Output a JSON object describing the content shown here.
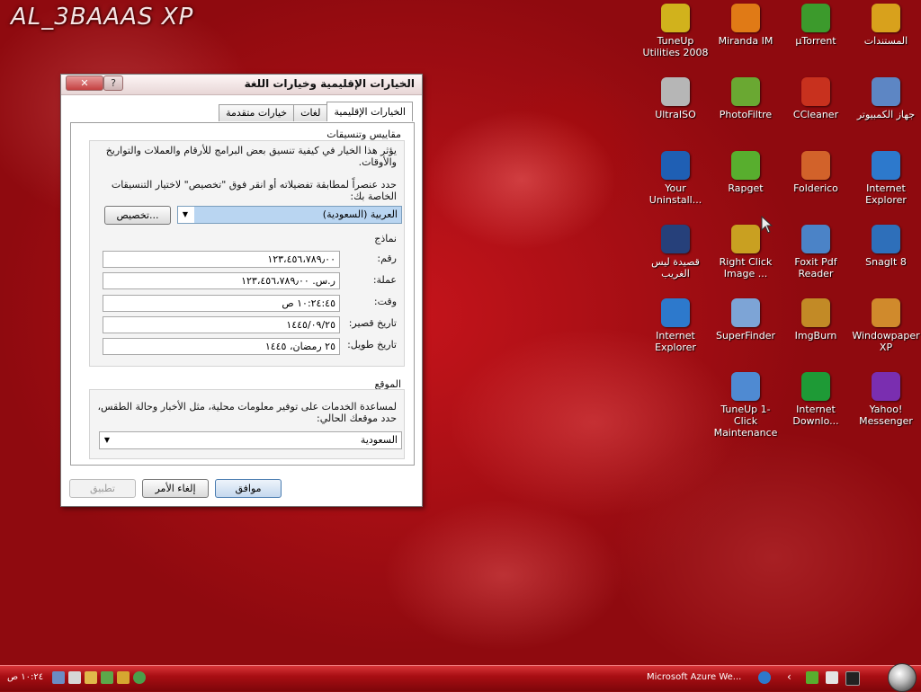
{
  "desktop": {
    "brand_text": "AL_3BAAAS XP",
    "icons": [
      {
        "label": "المستندات",
        "icon": "folder-icon",
        "color": "#d8a11c"
      },
      {
        "label": "µTorrent",
        "icon": "utorrent-icon",
        "color": "#3c9a2c"
      },
      {
        "label": "Miranda IM",
        "icon": "miranda-icon",
        "color": "#e07a16"
      },
      {
        "label": "TuneUp Utilities 2008",
        "icon": "tuneup-icon",
        "color": "#d1b21c"
      },
      {
        "label": "جهاز الكمبيوتر",
        "icon": "computer-icon",
        "color": "#5d86c4"
      },
      {
        "label": "CCleaner",
        "icon": "ccleaner-icon",
        "color": "#c8311e"
      },
      {
        "label": "PhotoFiltre",
        "icon": "photofiltre-icon",
        "color": "#6aa832"
      },
      {
        "label": "UltraISO",
        "icon": "disc-icon",
        "color": "#b6b6b6"
      },
      {
        "label": "Internet Explorer",
        "icon": "ie-icon",
        "color": "#2d79cc"
      },
      {
        "label": "Folderico",
        "icon": "folderico-icon",
        "color": "#d2622a"
      },
      {
        "label": "Rapget",
        "icon": "download-arrow-icon",
        "color": "#58ae2e"
      },
      {
        "label": "Your Uninstall...",
        "icon": "uninstall-icon",
        "color": "#1f5fb4"
      },
      {
        "label": "SnagIt 8",
        "icon": "snagit-icon",
        "color": "#2e6fba"
      },
      {
        "label": "Foxit Pdf Reader",
        "icon": "foxit-icon",
        "color": "#4b83c7"
      },
      {
        "label": "Right Click Image ...",
        "icon": "gear-icon",
        "color": "#c9a021"
      },
      {
        "label": "قصيدة ليس الغريب",
        "icon": "real-player-icon",
        "color": "#26407a"
      },
      {
        "label": "Windowpaper XP",
        "icon": "windowpaper-icon",
        "color": "#d08a2c"
      },
      {
        "label": "ImgBurn",
        "icon": "imgburn-icon",
        "color": "#c28a26"
      },
      {
        "label": "SuperFinder",
        "icon": "magnifier-icon",
        "color": "#7da4d6"
      },
      {
        "label": "Internet Explorer",
        "icon": "ie-icon",
        "color": "#2d79cc"
      },
      {
        "label": "Yahoo! Messenger",
        "icon": "yahoo-icon",
        "color": "#7a2eb0"
      },
      {
        "label": "Internet Downlo...",
        "icon": "idm-icon",
        "color": "#1e9a36"
      },
      {
        "label": "TuneUp 1-Click Maintenance",
        "icon": "tuneup-click-icon",
        "color": "#4f8ad2"
      }
    ]
  },
  "dialog": {
    "title": "الخيارات الإقليمية وخيارات اللغة",
    "close_glyph": "✕",
    "help_glyph": "?",
    "tabs": [
      {
        "label": "الخيارات الإقليمية",
        "active": true
      },
      {
        "label": "لغات",
        "active": false
      },
      {
        "label": "خيارات متقدمة",
        "active": false
      }
    ],
    "standards": {
      "group_title": "مقاييس وتنسيقات",
      "description": "يؤثر هذا الخيار في كيفية تنسيق بعض البرامج للأرقام والعملات والتواريخ والأوقات.",
      "instruction": "حدد عنصراً لمطابقة تفضيلاته أو انقر فوق \"تخصيص\" لاختيار التنسيقات الخاصة بك:",
      "format_value": "العربية (السعودية)",
      "customize_label": "تخصيص...",
      "samples_title": "نماذج",
      "samples": [
        {
          "label": "رقم:",
          "value": "١٢٣،٤٥٦،٧٨٩٫٠٠"
        },
        {
          "label": "عملة:",
          "value": "ر.س. ١٢٣،٤٥٦،٧٨٩٫٠٠"
        },
        {
          "label": "وقت:",
          "value": "١٠:٢٤:٤٥ ص"
        },
        {
          "label": "تاريخ قصير:",
          "value": "١٤٤٥/٠٩/٢٥"
        },
        {
          "label": "تاريخ طويل:",
          "value": "٢٥ رمضان، ١٤٤٥"
        }
      ]
    },
    "location": {
      "group_title": "الموقع",
      "description": "لمساعدة الخدمات على توفير معلومات محلية، مثل الأخبار وحالة الطقس، حدد موقعك الحالي:",
      "value": "السعودية"
    },
    "buttons": {
      "ok": "موافق",
      "cancel": "إلغاء الأمر",
      "apply": "تطبيق"
    }
  },
  "taskbar": {
    "clock": "١٠:٢٤ ص",
    "active_task": "Microsoft Azure We...",
    "quicklaunch_chevron": "‹"
  }
}
